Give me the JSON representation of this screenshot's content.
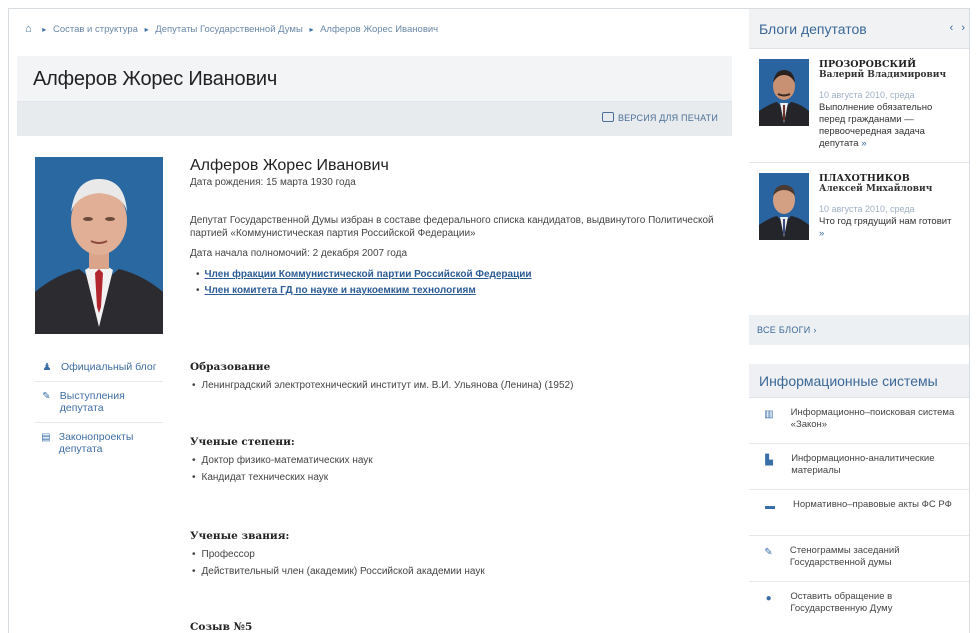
{
  "breadcrumb": {
    "items": [
      "Состав и структура",
      "Депутаты Государственной Думы",
      "Алферов Жорес Иванович"
    ]
  },
  "page": {
    "title": "Алферов Жорес Иванович",
    "print_label": "ВЕРСИЯ ДЛЯ ПЕЧАТИ"
  },
  "side_links": [
    {
      "icon": "person-icon",
      "label": "Официальный блог"
    },
    {
      "icon": "pen-icon",
      "label": "Выступления депутата"
    },
    {
      "icon": "document-icon",
      "label": "Законопроекты депутата"
    }
  ],
  "profile": {
    "name": "Алферов Жорес Иванович",
    "dob": "Дата рождения: 15 марта 1930 года",
    "description": "Депутат Государственной Думы избран в составе федерального списка кандидатов, выдвинутого Политической партией «Коммунистическая партия Российской Федерации»",
    "term_start": "Дата начала полномочий: 2 декабря 2007 года",
    "links": [
      "Член фракции Коммунистической партии Российской Федерации",
      "Член комитета ГД по науке и наукоемким технологиям"
    ]
  },
  "sections": {
    "education": {
      "title": "Образование",
      "items": [
        "Ленинградский электротехнический институт им. В.И. Ульянова (Ленина) (1952)"
      ]
    },
    "degrees": {
      "title": "Ученые степени:",
      "items": [
        "Доктор физико-математических наук",
        "Кандидат технических наук"
      ]
    },
    "titles": {
      "title": "Ученые звания:",
      "items": [
        "Профессор",
        "Действительный член (академик) Российской академии наук"
      ]
    },
    "convocation": {
      "title": "Созыв №5"
    }
  },
  "blogs": {
    "title": "Блоги депутатов",
    "prev": "‹",
    "next": "›",
    "items": [
      {
        "name_last": "ПРОЗОРОВСКИЙ",
        "name_first": "Валерий Владимирович",
        "date": "10 августа 2010, среда",
        "text": "Выполнение обязательно перед гражданами — первоочередная задача депутата",
        "more": "»"
      },
      {
        "name_last": "ПЛАХОТНИКОВ",
        "name_first": "Алексей Михайлович",
        "date": "10 августа 2010, среда",
        "text": "Что год грядущий нам готовит",
        "more": "»"
      }
    ],
    "all_label": "ВСЕ БЛОГИ ›"
  },
  "info_systems": {
    "title": "Информационные системы",
    "items": [
      {
        "icon": "book-icon",
        "label": "Информационно–поисковая система «Закон»"
      },
      {
        "icon": "chart-icon",
        "label": "Информационно-аналитические материалы"
      },
      {
        "icon": "folder-icon",
        "label": "Нормативно–правовые акты ФС РФ"
      },
      {
        "icon": "pen-icon",
        "label": "Стенограммы заседаний Государственной думы"
      },
      {
        "icon": "chat-icon",
        "label": "Оставить обращение в Государственную Думу"
      }
    ]
  },
  "colors": {
    "accent": "#3b6897",
    "link": "#2c5c95",
    "photo_bg": "#2f6fa8"
  }
}
